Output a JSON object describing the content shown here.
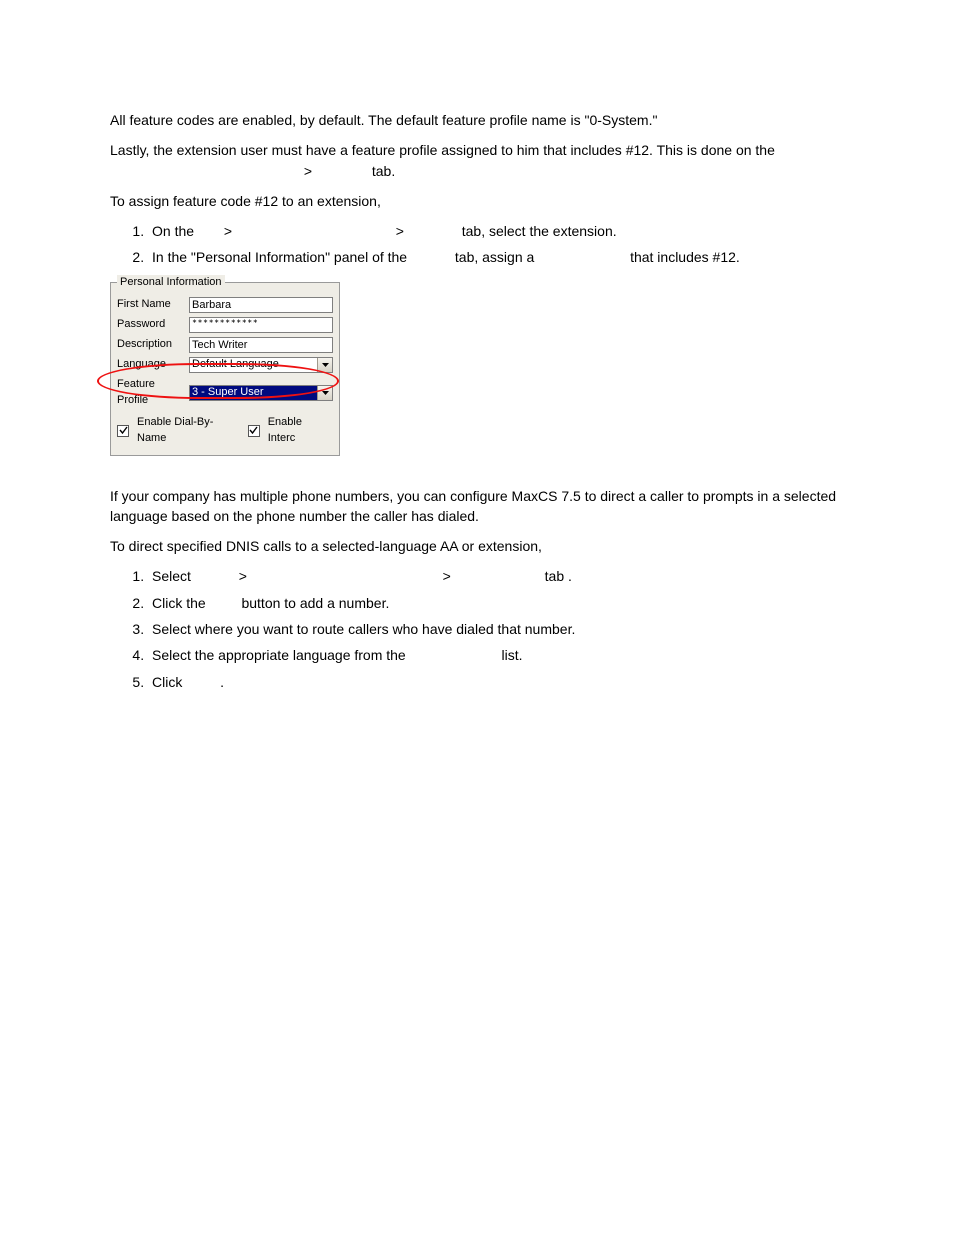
{
  "body": {
    "p1": "All feature codes are enabled, by default. The default feature profile name is \"0-System.\"",
    "p2_a": "Lastly, the extension user must have a feature profile assigned to him that includes #12. This is done on the",
    "p2_b": " > ",
    "p2_c": " tab.",
    "p3": "To assign feature code #12 to an extension,",
    "list1": {
      "i1_a": "On the ",
      "i1_b": " > ",
      "i1_c": " > ",
      "i1_d": " tab, select the extension.",
      "i2_a": "In the \"Personal Information\" panel of the ",
      "i2_b": " tab, assign a ",
      "i2_c": " that includes #12."
    },
    "heading": "",
    "p4": "If your company has multiple phone numbers, you can configure MaxCS 7.5  to direct a caller to prompts in a selected language based on the phone number the caller has dialed.",
    "p5": "To direct specified DNIS calls to a selected-language AA or extension,",
    "list2": {
      "i1_a": "Select ",
      "i1_b": " > ",
      "i1_c": " > ",
      "i1_d": " tab .",
      "i2_a": "Click the ",
      "i2_b": " button to add a number.",
      "i3": "Select where you want to route callers who have dialed that number.",
      "i4_a": "Select the appropriate language from the ",
      "i4_b": " list.",
      "i5_a": "Click ",
      "i5_b": "."
    }
  },
  "panel": {
    "legend": "Personal Information",
    "labels": {
      "first_name": "First Name",
      "password": "Password",
      "description": "Description",
      "language": "Language",
      "feature_profile": "Feature Profile"
    },
    "values": {
      "first_name": "Barbara",
      "password": "∗∗∗∗∗∗∗∗∗∗∗∗",
      "description": "Tech Writer",
      "language": "Default Language",
      "feature_profile": "3 - Super User"
    },
    "checks": {
      "dial_by_name": "Enable Dial-By-Name",
      "intercom": "Enable Interc"
    }
  }
}
